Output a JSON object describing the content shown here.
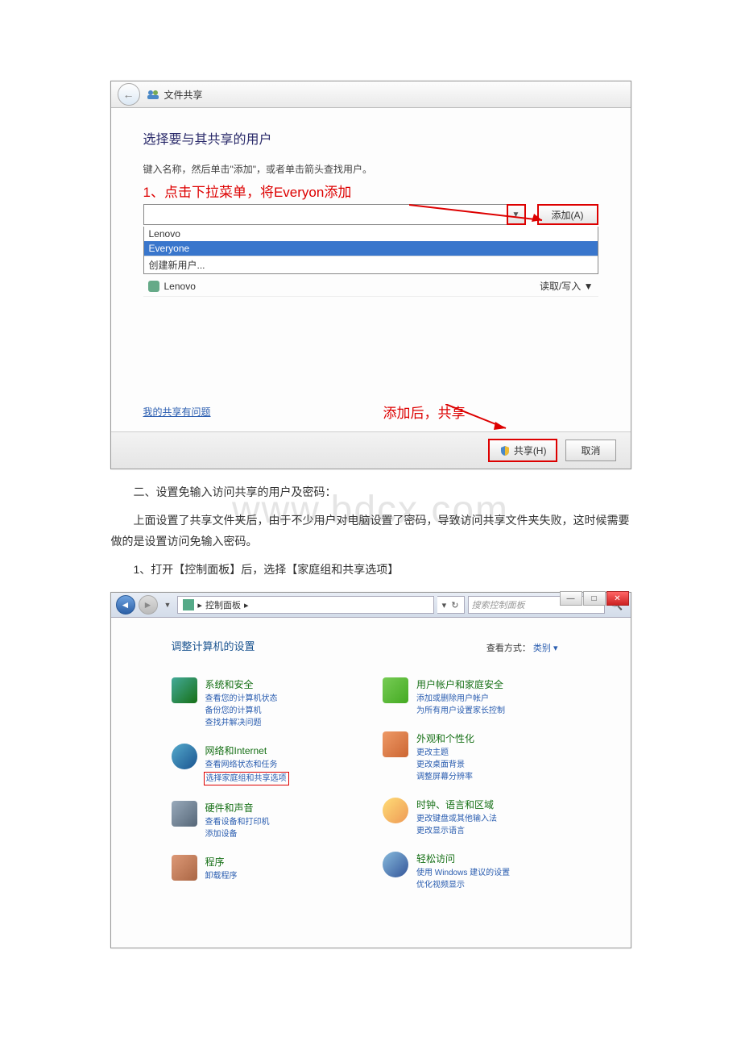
{
  "watermark": "www.bdcx.com",
  "screenshot1": {
    "window_title": "文件共享",
    "heading": "选择要与其共享的用户",
    "subtext": "键入名称，然后单击\"添加\"，或者单击箭头查找用户。",
    "annotation1": "1、点击下拉菜单，将Everyon添加",
    "dropdown_icon": "▼",
    "add_button": "添加(A)",
    "dropdown_items": {
      "item1": "Lenovo",
      "item2": "Everyone",
      "item3": "创建新用户..."
    },
    "perm_user": "Lenovo",
    "perm_level": "读取/写入 ▼",
    "help_link": "我的共享有问题",
    "annotation2": "添加后，共享",
    "share_button": "共享(H)",
    "cancel_button": "取消"
  },
  "body": {
    "p1": "二、设置免输入访问共享的用户及密码：",
    "p2": "上面设置了共享文件夹后，由于不少用户对电脑设置了密码，导致访问共享文件夹失败，这时候需要做的是设置访问免输入密码。",
    "p3": "1、打开【控制面板】后，选择【家庭组和共享选项】"
  },
  "screenshot2": {
    "breadcrumb_sep": "▸",
    "breadcrumb": "控制面板",
    "refresh_sep": "▾",
    "refresh_icon": "↻",
    "search_placeholder": "搜索控制面板",
    "search_icon": "🔍",
    "heading": "调整计算机的设置",
    "viewby_label": "查看方式：",
    "viewby_value": "类别 ▾",
    "categories": {
      "left": [
        {
          "title": "系统和安全",
          "links": [
            "查看您的计算机状态",
            "备份您的计算机",
            "查找并解决问题"
          ]
        },
        {
          "title": "网络和Internet",
          "links": [
            "查看网络状态和任务",
            "选择家庭组和共享选项"
          ]
        },
        {
          "title": "硬件和声音",
          "links": [
            "查看设备和打印机",
            "添加设备"
          ]
        },
        {
          "title": "程序",
          "links": [
            "卸载程序"
          ]
        }
      ],
      "right": [
        {
          "title": "用户帐户和家庭安全",
          "links": [
            "添加或删除用户帐户",
            "为所有用户设置家长控制"
          ]
        },
        {
          "title": "外观和个性化",
          "links": [
            "更改主题",
            "更改桌面背景",
            "调整屏幕分辨率"
          ]
        },
        {
          "title": "时钟、语言和区域",
          "links": [
            "更改键盘或其他输入法",
            "更改显示语言"
          ]
        },
        {
          "title": "轻松访问",
          "links": [
            "使用 Windows 建议的设置",
            "优化视频显示"
          ]
        }
      ]
    },
    "win_min": "—",
    "win_max": "□",
    "win_close": "✕"
  }
}
